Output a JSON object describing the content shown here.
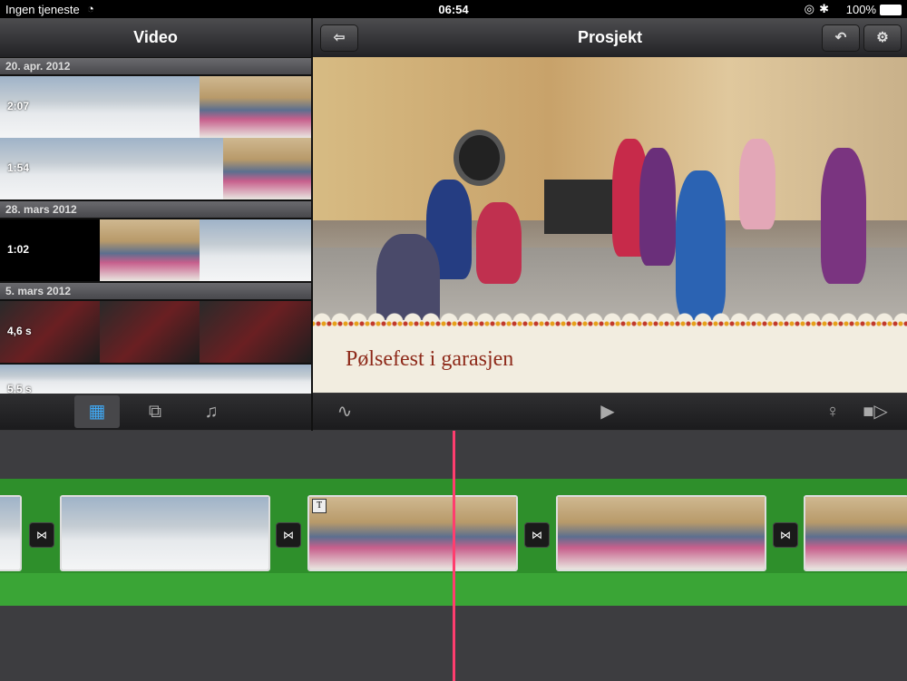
{
  "status": {
    "carrier": "Ingen tjeneste",
    "time": "06:54",
    "battery": "100%"
  },
  "left_header": {
    "title": "Video"
  },
  "right_header": {
    "title": "Prosjekt"
  },
  "browser": {
    "sections": [
      {
        "date": "20. apr. 2012",
        "clips": [
          {
            "duration": "2:07"
          },
          {
            "duration": "1:54"
          }
        ]
      },
      {
        "date": "28. mars 2012",
        "clips": [
          {
            "duration": "1:02"
          }
        ]
      },
      {
        "date": "5. mars 2012",
        "clips": [
          {
            "duration": "4,6 s"
          },
          {
            "duration": "5,5 s"
          }
        ]
      }
    ]
  },
  "viewer": {
    "title_text": "Pølsefest i garasjen"
  },
  "left_toolbar": {
    "icons": [
      "film-icon",
      "photos-icon",
      "music-note-icon"
    ]
  },
  "right_toolbar": {
    "icons": [
      "waveform-icon",
      "play-icon",
      "microphone-icon",
      "video-camera-icon"
    ]
  },
  "timeline": {
    "title_marker": "T"
  },
  "colors": {
    "accent": "#3fa9f5",
    "playhead": "#ff3d6e",
    "timeline_green": "#2e8f2b",
    "title_color": "#8e2a1a"
  }
}
